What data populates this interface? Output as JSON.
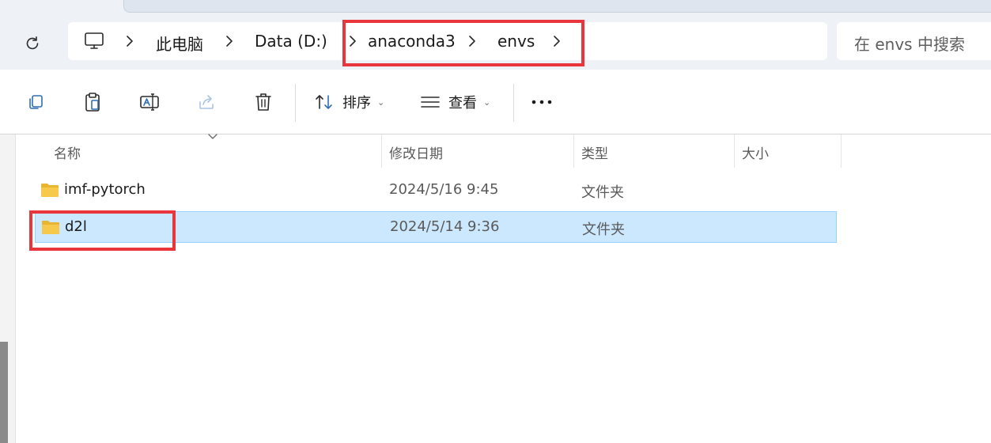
{
  "address_bar": {
    "breadcrumbs": [
      {
        "label": "此电脑"
      },
      {
        "label": "Data (D:)"
      },
      {
        "label": "anaconda3"
      },
      {
        "label": "envs"
      }
    ],
    "search_placeholder": "在 envs 中搜索"
  },
  "toolbar": {
    "sort_label": "排序",
    "view_label": "查看"
  },
  "columns": {
    "name": "名称",
    "date_modified": "修改日期",
    "type": "类型",
    "size": "大小"
  },
  "files": [
    {
      "name": "imf-pytorch",
      "date": "2024/5/16 9:45",
      "type": "文件夹",
      "selected": false
    },
    {
      "name": "d2l",
      "date": "2024/5/14 9:36",
      "type": "文件夹",
      "selected": true
    }
  ],
  "colors": {
    "highlight_box": "#e8363c",
    "selection_bg": "#cce8ff",
    "selection_border": "#99d1ff",
    "folder": "#f6c94b"
  },
  "icons": [
    "monitor-icon",
    "refresh-icon",
    "chevron-right-icon",
    "copy-icon",
    "paste-icon",
    "rename-icon",
    "share-icon",
    "delete-icon",
    "sort-icon",
    "view-icon",
    "more-icon",
    "folder-icon"
  ]
}
